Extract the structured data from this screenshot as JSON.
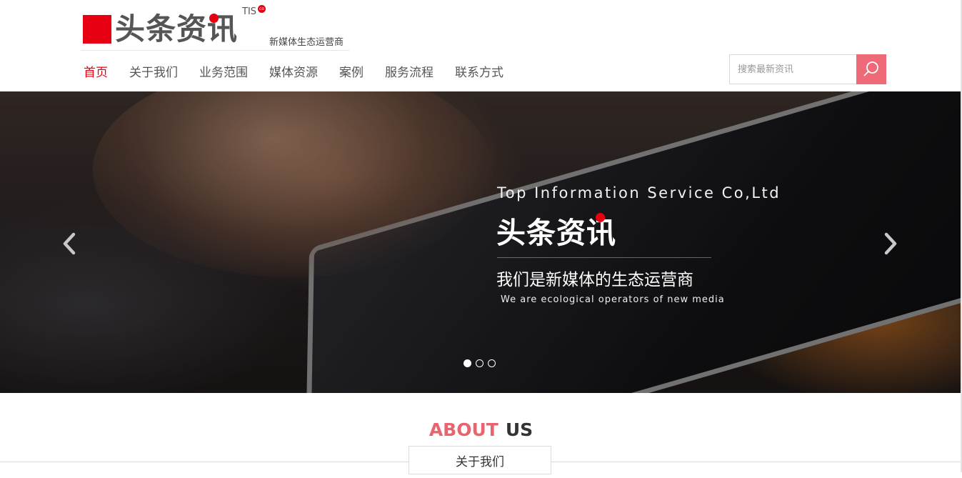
{
  "brand": {
    "name": "头条资讯",
    "mark": "TIS",
    "mark_badge": "co",
    "slogan": "新媒体生态运营商",
    "accent_color": "#e60012"
  },
  "nav": {
    "items": [
      {
        "label": "首页",
        "active": true
      },
      {
        "label": "关于我们",
        "active": false
      },
      {
        "label": "业务范围",
        "active": false
      },
      {
        "label": "媒体资源",
        "active": false
      },
      {
        "label": "案例",
        "active": false
      },
      {
        "label": "服务流程",
        "active": false
      },
      {
        "label": "联系方式",
        "active": false
      }
    ]
  },
  "search": {
    "placeholder": "搜索最新资讯",
    "value": "",
    "button_color": "#ee6a78"
  },
  "banner": {
    "en_title": "Top Information Service Co,Ltd",
    "logo_text": "头条资讯",
    "cn_tagline": "我们是新媒体的生态运营商",
    "en_tagline": "We are ecological operators of new media",
    "slide_count": 3,
    "active_slide": 1
  },
  "about": {
    "title_red": "ABOUT",
    "title_dark": "US",
    "tab_label": "关于我们",
    "title_red_color": "#e8646f"
  },
  "icons": {
    "search": "search-icon",
    "prev": "chevron-left-icon",
    "next": "chevron-right-icon"
  }
}
